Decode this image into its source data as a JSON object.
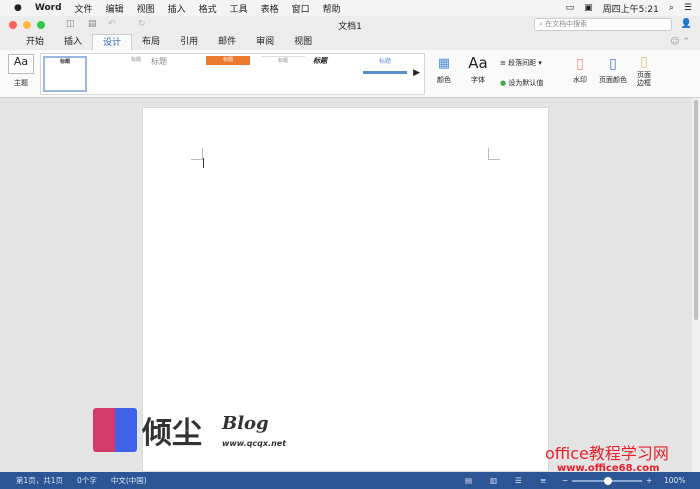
{
  "menubar": {
    "app": "Word",
    "items": [
      "文件",
      "编辑",
      "视图",
      "插入",
      "格式",
      "工具",
      "表格",
      "窗口",
      "帮助"
    ],
    "clock": "周四上午5:21"
  },
  "window": {
    "title": "文档1",
    "search_placeholder": "在文档中搜索"
  },
  "tabs": [
    "开始",
    "插入",
    "设计",
    "布局",
    "引用",
    "邮件",
    "审阅",
    "视图"
  ],
  "ribbon": {
    "theme": "主题",
    "styles": [
      "标题",
      "标题",
      "标题",
      "标题",
      "标题",
      "标题",
      "标题"
    ],
    "colors": "颜色",
    "fonts": "字体",
    "fonts_glyph": "Aa",
    "paragraph_spacing": "段落间距",
    "set_default": "设为默认值",
    "watermark": "水印",
    "page_color": "页面颜色",
    "page_borders": "页面边框"
  },
  "status": {
    "page": "第1页，共1页",
    "words": "0个字",
    "language": "中文(中国)",
    "zoom": "100%"
  },
  "watermarks": {
    "blog_name": "倾尘",
    "blog": "Blog",
    "blog_url": "www.qcqx.net",
    "site": "office教程学习网",
    "site_url": "www.office68.com"
  }
}
